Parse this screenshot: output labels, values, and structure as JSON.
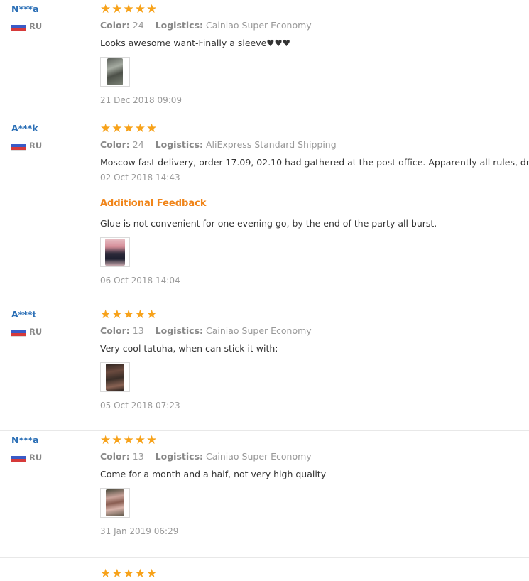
{
  "colors": {
    "username": "#2b6fb6",
    "star": "#f7a21a",
    "additional_feedback": "#f0851a",
    "muted": "#999999"
  },
  "icons": {
    "star": "star-icon",
    "flag": "russia-flag-icon"
  },
  "reviews": [
    {
      "user": "N***a",
      "country": "RU",
      "rating": 5,
      "color_label": "Color:",
      "color_value": "24",
      "logistics_label": "Logistics:",
      "logistics_value": "Cainiao Super Economy",
      "text": "Looks awesome want-Finally a sleeve♥♥♥",
      "date": "21 Dec 2018 09:09"
    },
    {
      "user": "A***k",
      "country": "RU",
      "rating": 5,
      "color_label": "Color:",
      "color_value": "24",
      "logistics_label": "Logistics:",
      "logistics_value": "AliExpress Standard Shipping",
      "text": "Moscow fast delivery, order 17.09, 02.10 had gathered at the post office. Apparently all rules, drive have",
      "date": "02 Oct 2018 14:43",
      "additional": {
        "title": "Additional Feedback",
        "text": "Glue is not convenient for one evening go, by the end of the party all burst.",
        "date": "06 Oct 2018 14:04"
      }
    },
    {
      "user": "A***t",
      "country": "RU",
      "rating": 5,
      "color_label": "Color:",
      "color_value": "13",
      "logistics_label": "Logistics:",
      "logistics_value": "Cainiao Super Economy",
      "text": "Very cool tatuha, when can stick it with:",
      "date": "05 Oct 2018 07:23"
    },
    {
      "user": "N***a",
      "country": "RU",
      "rating": 5,
      "color_label": "Color:",
      "color_value": "13",
      "logistics_label": "Logistics:",
      "logistics_value": "Cainiao Super Economy",
      "text": "Come for a month and a half, not very high quality",
      "date": "31 Jan 2019 06:29"
    }
  ]
}
